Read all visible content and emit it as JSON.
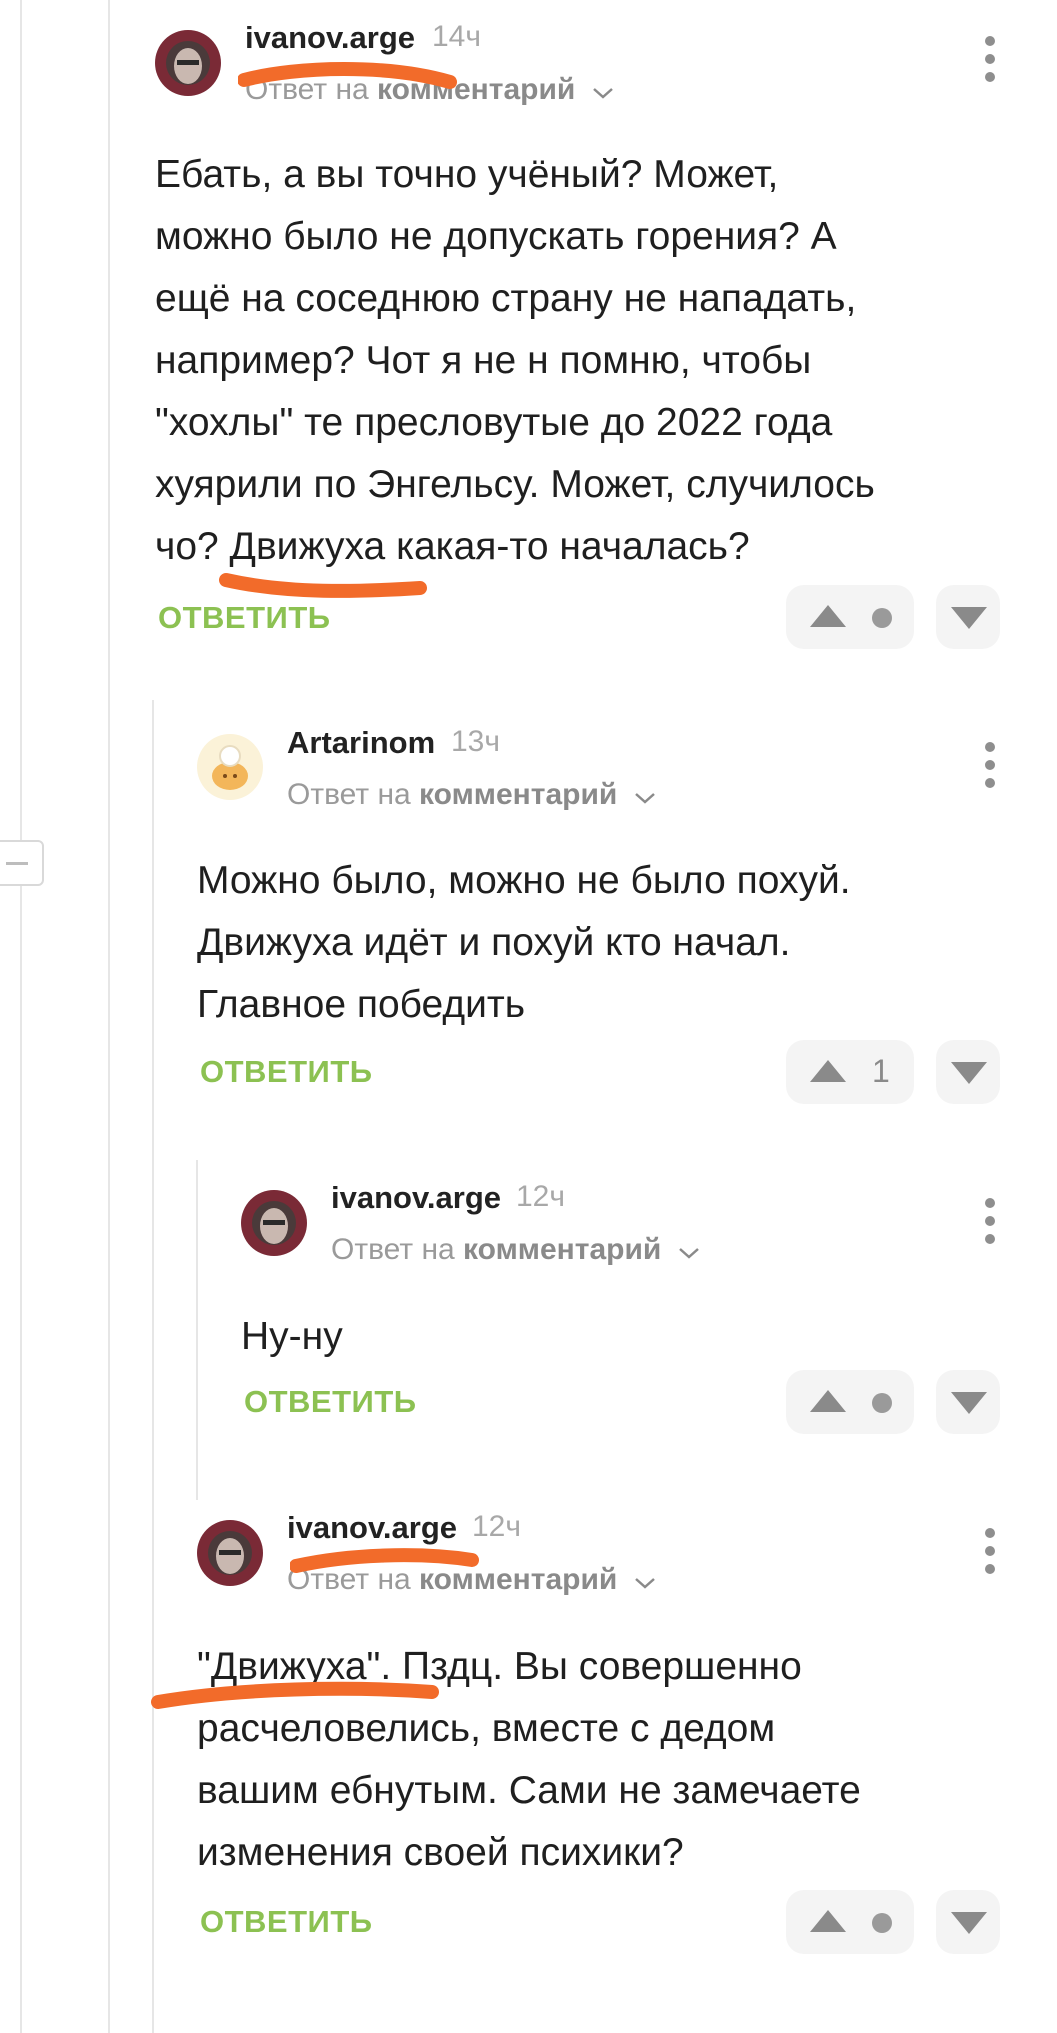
{
  "comments": [
    {
      "username": "ivanov.arge",
      "time": "14ч",
      "reply_prefix": "Ответ на",
      "reply_target": "комментарий",
      "lines": [
        "Ебать, а вы точно учёный? Может,",
        "можно было не допускать горения? А",
        "ещё на соседнюю страну не нападать,",
        "например? Чот я не н помню, чтобы",
        "\"хохлы\" те пресловутые до 2022 года",
        "хуярили по Энгельсу. Может, случилось",
        "чо? Движуха какая-то началась?"
      ],
      "reply_label": "ОТВЕТИТЬ",
      "score": ""
    },
    {
      "username": "Artarinom",
      "time": "13ч",
      "reply_prefix": "Ответ на",
      "reply_target": "комментарий",
      "lines": [
        "Можно было, можно не было похуй.",
        "Движуха идёт и похуй кто начал.",
        "Главное победить"
      ],
      "reply_label": "ОТВЕТИТЬ",
      "score": "1"
    },
    {
      "username": "ivanov.arge",
      "time": "12ч",
      "reply_prefix": "Ответ на",
      "reply_target": "комментарий",
      "lines": [
        "Ну-ну"
      ],
      "reply_label": "ОТВЕТИТЬ",
      "score": ""
    },
    {
      "username": "ivanov.arge",
      "time": "12ч",
      "reply_prefix": "Ответ на",
      "reply_target": "комментарий",
      "lines": [
        "\"Движуха\". Пздц. Вы совершенно",
        "расчеловелись, вместе с дедом",
        "вашим ебнутым. Сами не замечаете",
        "изменения своей психики?"
      ],
      "reply_label": "ОТВЕТИТЬ",
      "score": ""
    }
  ],
  "icons": {
    "upvote": "upvote-arrow-icon",
    "downvote": "downvote-arrow-icon",
    "menu": "more-vertical-icon",
    "chevron": "chevron-down-icon"
  },
  "colors": {
    "reply_green": "#8cc152",
    "highlight_orange": "#f26b2a",
    "muted_grey": "#9a9a9a"
  }
}
